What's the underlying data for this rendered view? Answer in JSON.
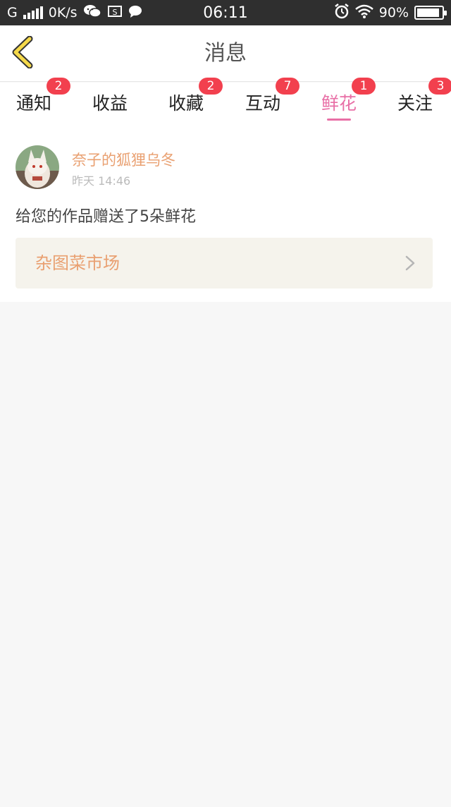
{
  "status_bar": {
    "carrier": "G",
    "speed": "0K/s",
    "time": "06:11",
    "battery": "90%",
    "battery_level": 0.9
  },
  "header": {
    "title": "消息"
  },
  "tabs": [
    {
      "label": "通知",
      "badge": "2"
    },
    {
      "label": "收益",
      "badge": ""
    },
    {
      "label": "收藏",
      "badge": "2"
    },
    {
      "label": "互动",
      "badge": "7"
    },
    {
      "label": "鲜花",
      "badge": "1",
      "active": true
    },
    {
      "label": "关注",
      "badge": "3"
    }
  ],
  "message_card": {
    "username": "奈子的狐狸乌冬",
    "time": "昨天 14:46",
    "text": "给您的作品赠送了5朵鲜花",
    "link_label": "杂图菜市场"
  },
  "colors": {
    "accent": "#e86fa6",
    "orange_text": "#e9a071",
    "badge": "#f2404e"
  }
}
